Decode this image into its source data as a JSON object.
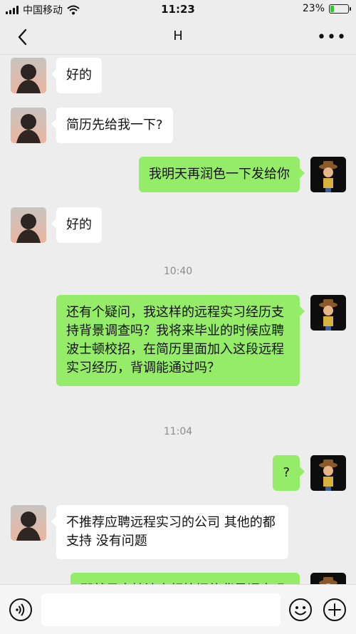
{
  "status_bar": {
    "carrier": "中国移动",
    "time": "11:23",
    "battery_percent": "23%",
    "battery_level": 0.23,
    "battery_color": "#3cc13c"
  },
  "nav": {
    "title": "H",
    "back_icon": "chevron-left-icon",
    "more_icon": "more-dots-icon",
    "more_label": "•••"
  },
  "colors": {
    "background": "#ededed",
    "incoming_bubble": "#ffffff",
    "outgoing_bubble": "#95ec69",
    "timestamp_text": "#8c8c8c"
  },
  "messages": [
    {
      "type": "in",
      "text": "好的"
    },
    {
      "type": "in",
      "text": "简历先给我一下?"
    },
    {
      "type": "out",
      "text": "我明天再润色一下发给你"
    },
    {
      "type": "in",
      "text": "好的"
    },
    {
      "type": "time",
      "text": "10:40"
    },
    {
      "type": "out",
      "text": "还有个疑问，我这样的远程实习经历支持背景调查吗？我将来毕业的时候应聘波士顿校招，在简历里面加入这段远程实习经历，背调能通过吗？"
    },
    {
      "type": "time",
      "text": "11:04"
    },
    {
      "type": "out",
      "text": "?"
    },
    {
      "type": "in",
      "text": "不推荐应聘远程实习的公司 其他的都支持 没有问题"
    },
    {
      "type": "out",
      "text": "那就是支持波士顿校招的背景调查吗"
    }
  ],
  "input_bar": {
    "value": "",
    "voice_icon": "voice-icon",
    "emoji_icon": "emoji-icon",
    "plus_icon": "plus-icon"
  }
}
